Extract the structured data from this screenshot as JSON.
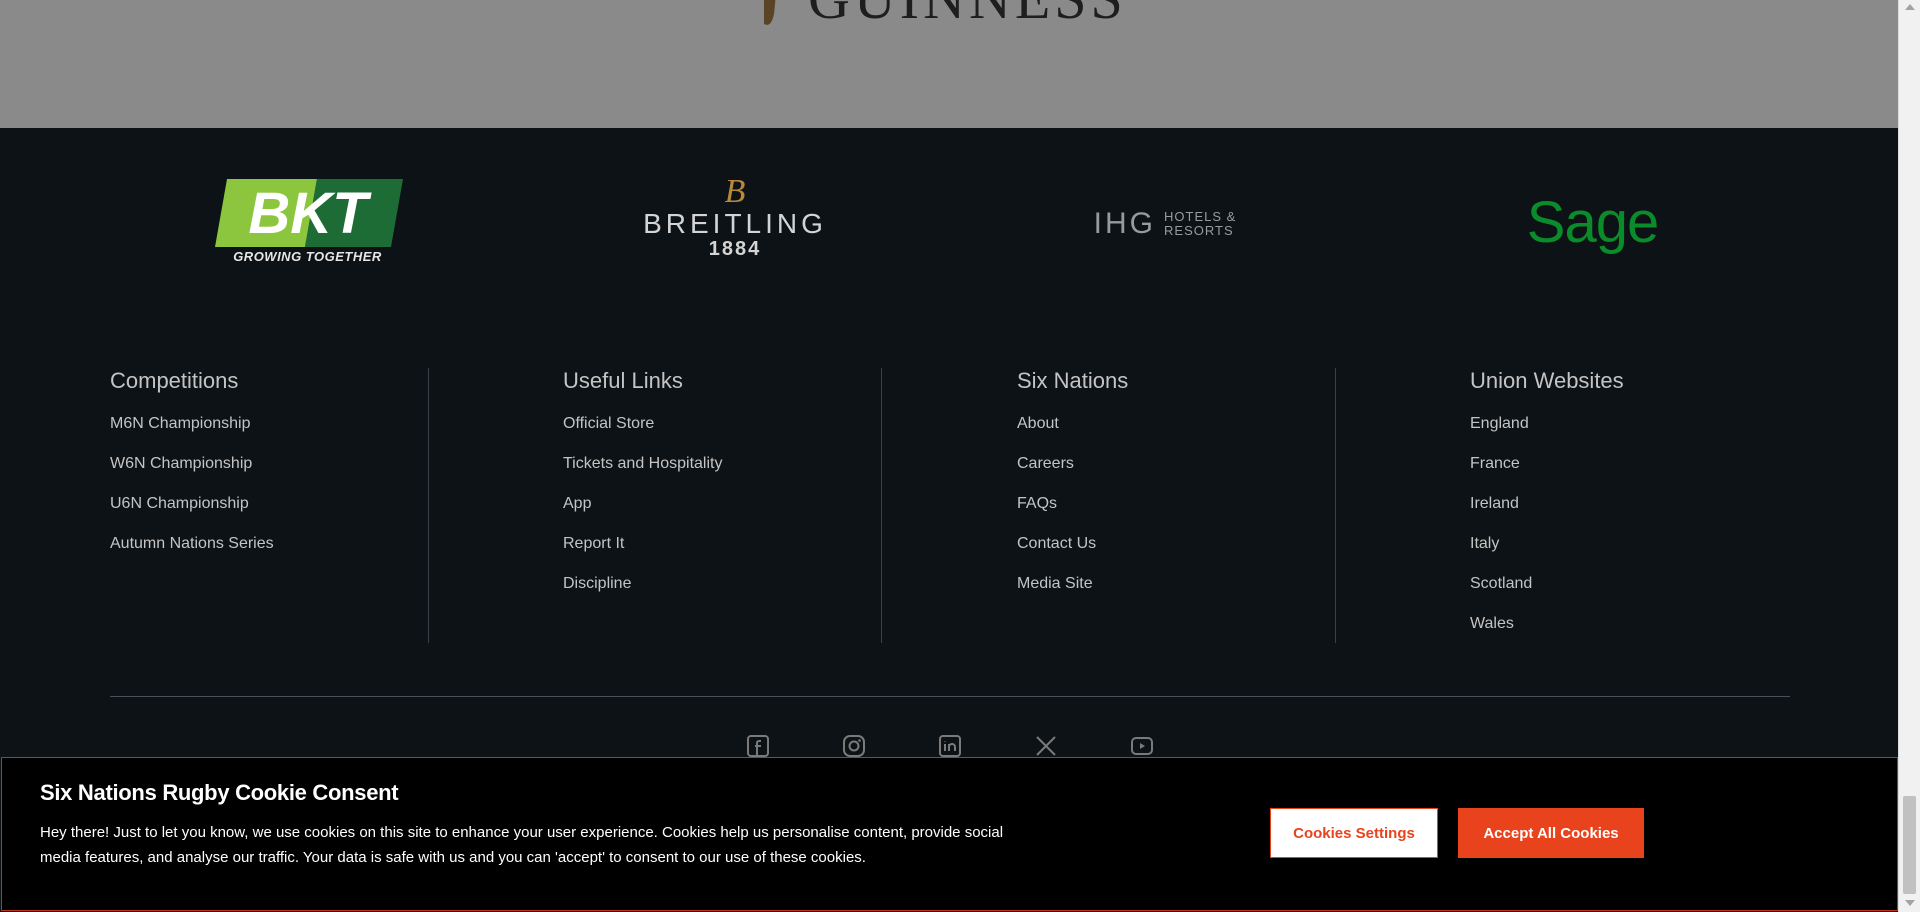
{
  "sponsors": {
    "top": {
      "name": "GUINNESS"
    },
    "bkt": {
      "mark": "BKT",
      "tagline": "GROWING TOGETHER",
      "colors": {
        "light_green": "#8cc63f",
        "dark_green": "#1d6b35"
      }
    },
    "breitling": {
      "monogram": "B",
      "name": "BREITLING",
      "year": "1884",
      "colors": {
        "gold": "#b8893b"
      }
    },
    "ihg": {
      "mark": "IHG",
      "sub_line1": "HOTELS &",
      "sub_line2": "RESORTS"
    },
    "sage": {
      "name": "Sage",
      "color": "#0a8c2a"
    }
  },
  "columns": [
    {
      "title": "Competitions",
      "links": [
        "M6N Championship",
        "W6N Championship",
        "U6N Championship",
        "Autumn Nations Series"
      ]
    },
    {
      "title": "Useful Links",
      "links": [
        "Official Store",
        "Tickets and Hospitality",
        "App",
        "Report It",
        "Discipline"
      ]
    },
    {
      "title": "Six Nations",
      "links": [
        "About",
        "Careers",
        "FAQs",
        "Contact Us",
        "Media Site"
      ]
    },
    {
      "title": "Union Websites",
      "links": [
        "England",
        "France",
        "Ireland",
        "Italy",
        "Scotland",
        "Wales"
      ]
    }
  ],
  "social": [
    "facebook-icon",
    "instagram-icon",
    "linkedin-icon",
    "x-icon",
    "youtube-icon"
  ],
  "cookie": {
    "title": "Six Nations Rugby Cookie Consent",
    "text": "Hey there! Just to let you know, we use cookies on this site to enhance your user experience. Cookies help us personalise content, provide social media features, and analyse our traffic. Your data is safe with us and you can 'accept' to consent to our use of these cookies.",
    "settings_label": "Cookies Settings",
    "accept_label": "Accept All Cookies",
    "accent_color": "#e8431c"
  }
}
